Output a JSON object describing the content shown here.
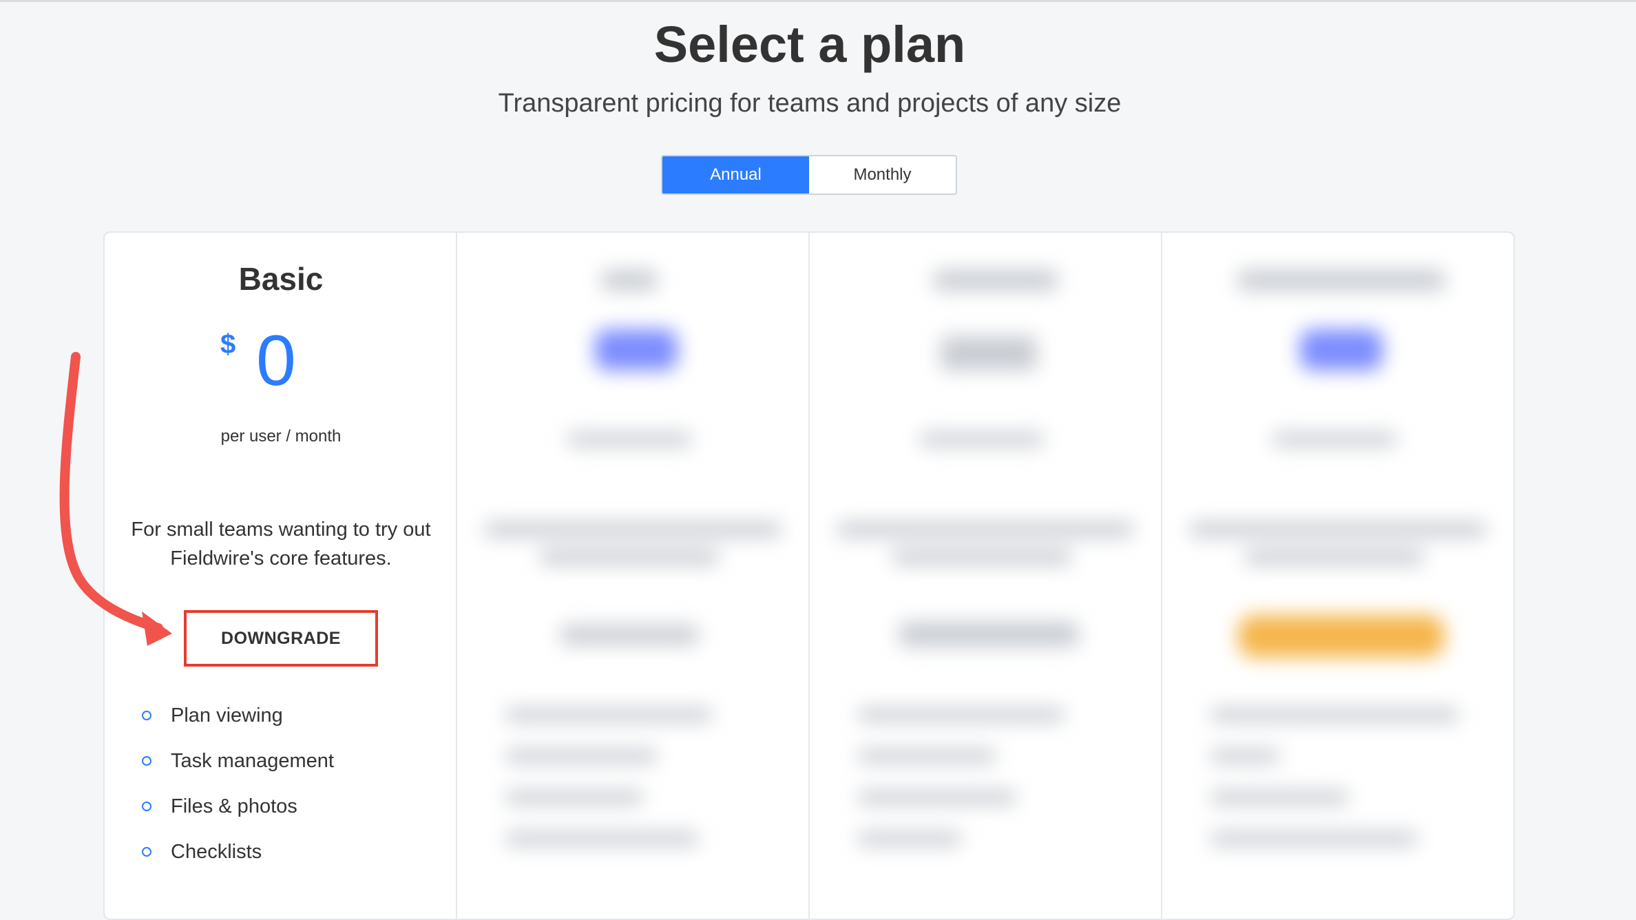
{
  "header": {
    "title": "Select a plan",
    "subtitle": "Transparent pricing for teams and projects of any size"
  },
  "billing_toggle": {
    "options": [
      {
        "label": "Annual",
        "selected": true
      },
      {
        "label": "Monthly",
        "selected": false
      }
    ]
  },
  "plans": [
    {
      "name": "Basic",
      "currency": "$",
      "price": "0",
      "period": "per user / month",
      "description": "For small teams wanting to try out Fieldwire's core features.",
      "button_label": "DOWNGRADE",
      "features": [
        "Plan viewing",
        "Task management",
        "Files & photos",
        "Checklists"
      ]
    }
  ],
  "colors": {
    "accent": "#2b7cff",
    "highlight_border": "#e53b2f",
    "arrow": "#f0544c",
    "background": "#f5f6f8"
  }
}
